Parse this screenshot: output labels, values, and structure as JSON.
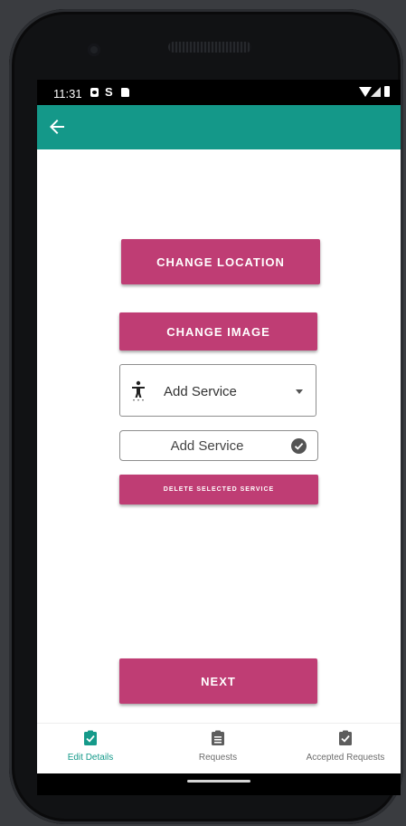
{
  "status_bar": {
    "time": "11:31",
    "left_icons": [
      "photo-icon",
      "s-icon",
      "sd-card-icon"
    ],
    "right_icons": [
      "wifi-icon",
      "signal-icon",
      "battery-icon"
    ]
  },
  "app_bar": {
    "back_icon": "arrow-left-icon",
    "color": "#149889"
  },
  "buttons": {
    "change_location": "CHANGE LOCATION",
    "change_image": "CHANGE IMAGE",
    "delete_selected_service": "DELETE SELECTED SERVICE",
    "next": "NEXT",
    "color": "#bf3d74"
  },
  "service_dropdown": {
    "icon": "accessibility-icon",
    "selected_label": "Add Service"
  },
  "service_input": {
    "placeholder": "Add Service",
    "value": "",
    "confirm_icon": "check-circle-icon"
  },
  "bottom_nav": {
    "items": [
      {
        "label": "Edit Details",
        "icon": "clipboard-check-icon",
        "active": true
      },
      {
        "label": "Requests",
        "icon": "clipboard-list-icon",
        "active": false
      },
      {
        "label": "Accepted Requests",
        "icon": "clipboard-check-icon",
        "active": false
      }
    ],
    "active_color": "#159a8a"
  }
}
